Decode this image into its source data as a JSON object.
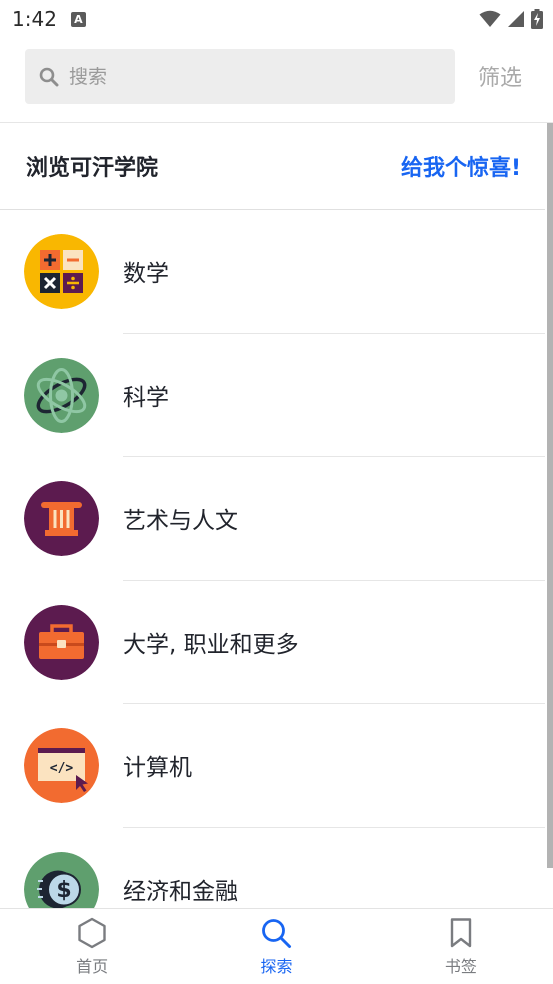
{
  "status_bar": {
    "time": "1:42",
    "notification_icon": "a-icon",
    "icons": [
      "wifi-icon",
      "signal-icon",
      "battery-charging-icon"
    ]
  },
  "search": {
    "placeholder": "搜索",
    "filter_label": "筛选"
  },
  "browse": {
    "title": "浏览可汗学院",
    "surprise_label": "给我个惊喜!"
  },
  "subjects": [
    {
      "label": "数学",
      "icon": "math-icon",
      "color": "#f9b701"
    },
    {
      "label": "科学",
      "icon": "science-atom-icon",
      "color": "#5f9f6e"
    },
    {
      "label": "艺术与人文",
      "icon": "column-icon",
      "color": "#5c1b4f"
    },
    {
      "label": "大学, 职业和更多",
      "icon": "toolbox-icon",
      "color": "#5c1b4f"
    },
    {
      "label": "计算机",
      "icon": "code-window-icon",
      "color": "#f26b30"
    },
    {
      "label": "经济和金融",
      "icon": "coin-dollar-icon",
      "color": "#5f9f6e"
    }
  ],
  "bottom_nav": [
    {
      "label": "首页",
      "icon": "home-hexagon-icon",
      "active": false
    },
    {
      "label": "探索",
      "icon": "search-icon",
      "active": true
    },
    {
      "label": "书签",
      "icon": "bookmark-icon",
      "active": false
    }
  ],
  "colors": {
    "accent": "#1865f2",
    "text": "#21242c",
    "muted": "#a9a9a9"
  }
}
